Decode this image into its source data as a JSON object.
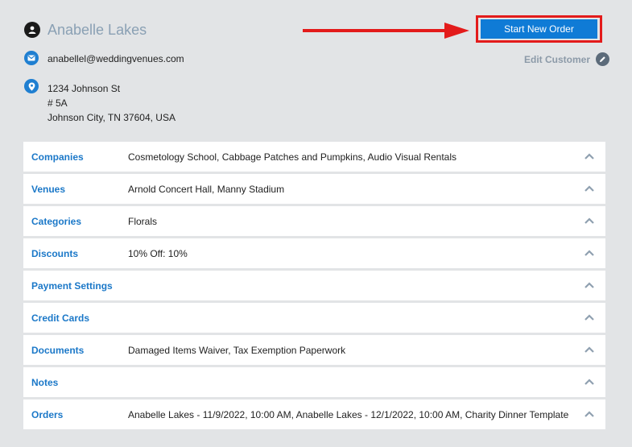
{
  "customer": {
    "name": "Anabelle Lakes",
    "email": "anabellel@weddingvenues.com",
    "address": {
      "line1": "1234 Johnson St",
      "line2": "# 5A",
      "line3": "Johnson City, TN 37604, USA"
    },
    "edit_label": "Edit Customer"
  },
  "actions": {
    "start_new_order": "Start New Order"
  },
  "colors": {
    "accent": "#1b78c8",
    "button": "#0f7bd6",
    "highlight": "#e31b1b",
    "background": "#e2e4e6"
  },
  "icons": {
    "name": "person-icon",
    "email": "mail-icon",
    "address": "map-pin-icon",
    "edit": "pencil-icon",
    "panel_toggle": "chevron-up-icon"
  },
  "panels": [
    {
      "label": "Companies",
      "value": "Cosmetology School, Cabbage Patches and Pumpkins, Audio Visual Rentals"
    },
    {
      "label": "Venues",
      "value": "Arnold Concert Hall, Manny Stadium"
    },
    {
      "label": "Categories",
      "value": "Florals"
    },
    {
      "label": "Discounts",
      "value": "10% Off: 10%"
    },
    {
      "label": "Payment Settings",
      "value": ""
    },
    {
      "label": "Credit Cards",
      "value": ""
    },
    {
      "label": "Documents",
      "value": "Damaged Items Waiver, Tax Exemption Paperwork"
    },
    {
      "label": "Notes",
      "value": ""
    },
    {
      "label": "Orders",
      "value": "Anabelle Lakes - 11/9/2022, 10:00 AM, Anabelle Lakes - 12/1/2022, 10:00 AM, Charity Dinner Template"
    }
  ]
}
